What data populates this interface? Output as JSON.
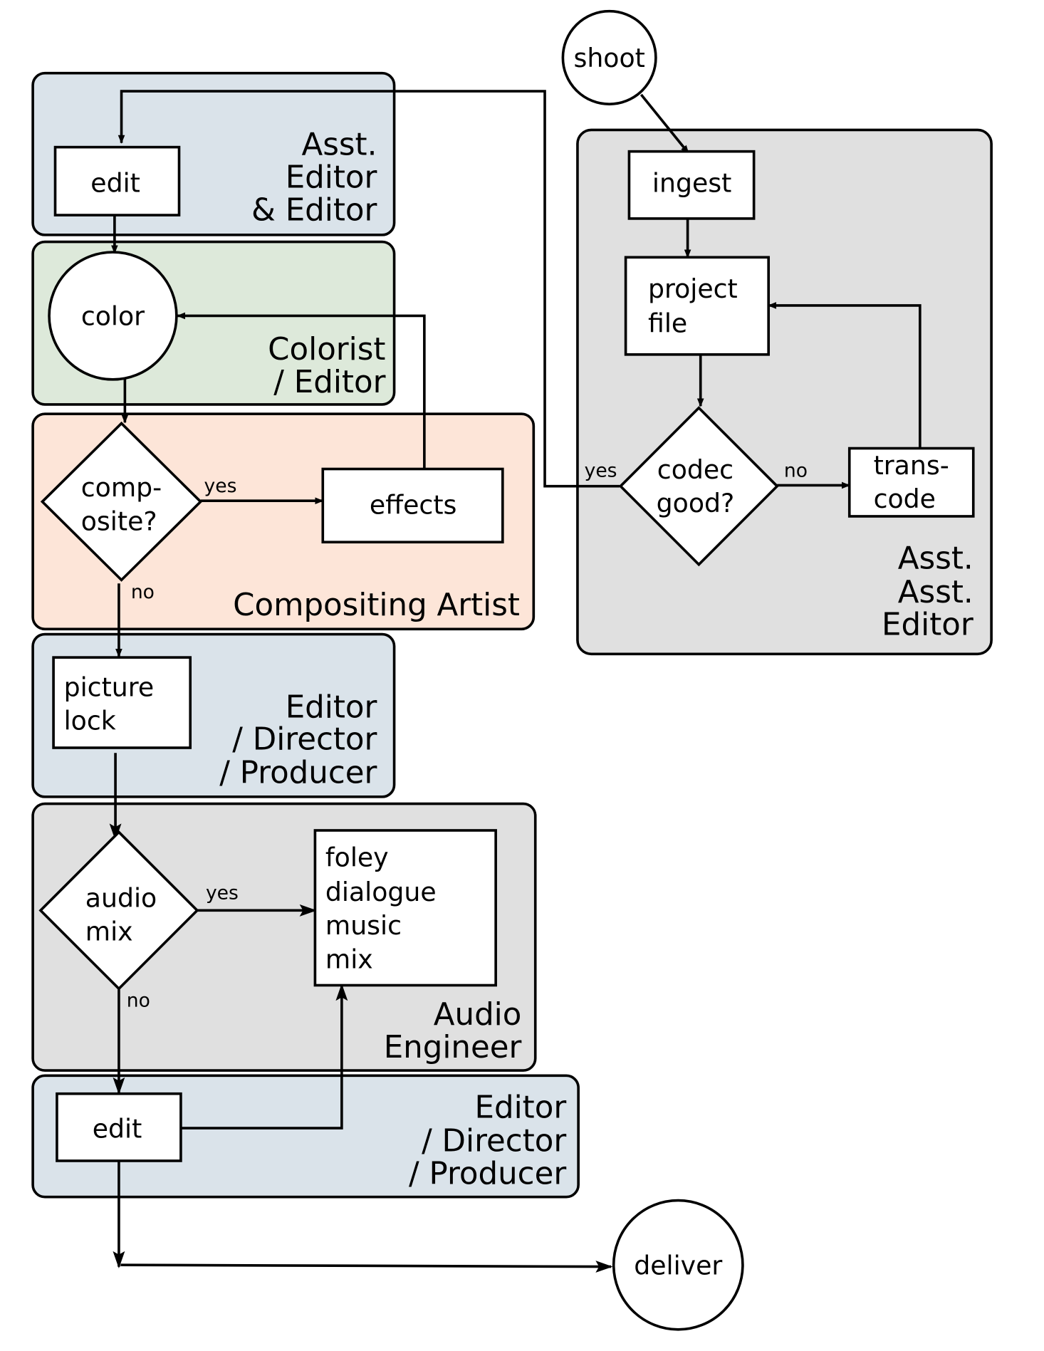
{
  "colors": {
    "lane_blue": "#dae3ea",
    "lane_green": "#dde9da",
    "lane_peach": "#fde5d8",
    "lane_gray": "#e0e0e0"
  },
  "lanes": {
    "asst_editor": [
      "Asst.",
      "Editor",
      "& Editor"
    ],
    "colorist": [
      "Colorist",
      "/ Editor"
    ],
    "compositing": [
      "Compositing Artist"
    ],
    "picture_lock": [
      "Editor",
      "/ Director",
      "/ Producer"
    ],
    "audio": [
      "Audio",
      "Engineer"
    ],
    "final_edit": [
      "Editor",
      "/ Director",
      "/ Producer"
    ],
    "asst_asst": [
      "Asst.",
      "Asst.",
      "Editor"
    ]
  },
  "nodes": {
    "shoot": "shoot",
    "ingest": "ingest",
    "project_file": [
      "project",
      "file"
    ],
    "codec_good": [
      "codec",
      "good?"
    ],
    "transcode": [
      "trans-",
      "code"
    ],
    "edit1": "edit",
    "color": "color",
    "composite": [
      "comp-",
      "osite?"
    ],
    "effects": "effects",
    "picture_lock": [
      "picture",
      "lock"
    ],
    "audio_mix": [
      "audio",
      "mix"
    ],
    "audio_tasks": [
      "foley",
      "dialogue",
      "music",
      "mix"
    ],
    "edit2": "edit",
    "deliver": "deliver"
  },
  "edge_labels": {
    "yes": "yes",
    "no": "no"
  }
}
